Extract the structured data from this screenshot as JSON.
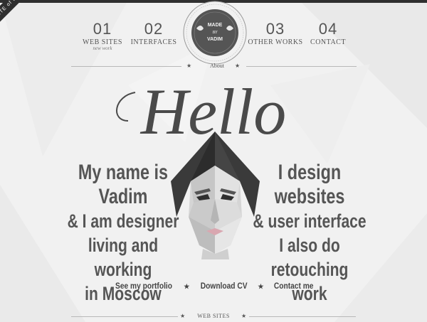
{
  "ribbon": {
    "text": "SITE of the DAY"
  },
  "nav": [
    {
      "num": "01",
      "label": "WEB SITES",
      "sub": "new work"
    },
    {
      "num": "02",
      "label": "INTERFACES"
    },
    {
      "num": "03",
      "label": "OTHER WORKS"
    },
    {
      "num": "04",
      "label": "CONTACT"
    }
  ],
  "badge": {
    "line1": "MADE",
    "line2": "BY",
    "line3": "VADIM"
  },
  "section": {
    "about": "About",
    "footer": "WEB SITES"
  },
  "hero": {
    "title": "Hello"
  },
  "intro_left": [
    "My name is Vadim",
    "& I am designer",
    "living and working",
    "in Moscow"
  ],
  "intro_right": [
    "I design websites",
    "& user interface",
    "I also do retouching",
    "work"
  ],
  "links": [
    "See my portfolio",
    "Download CV",
    "Contact me"
  ],
  "colors": {
    "dark": "#2f2f2f",
    "text": "#555555",
    "bg": "#f1f1f1"
  }
}
